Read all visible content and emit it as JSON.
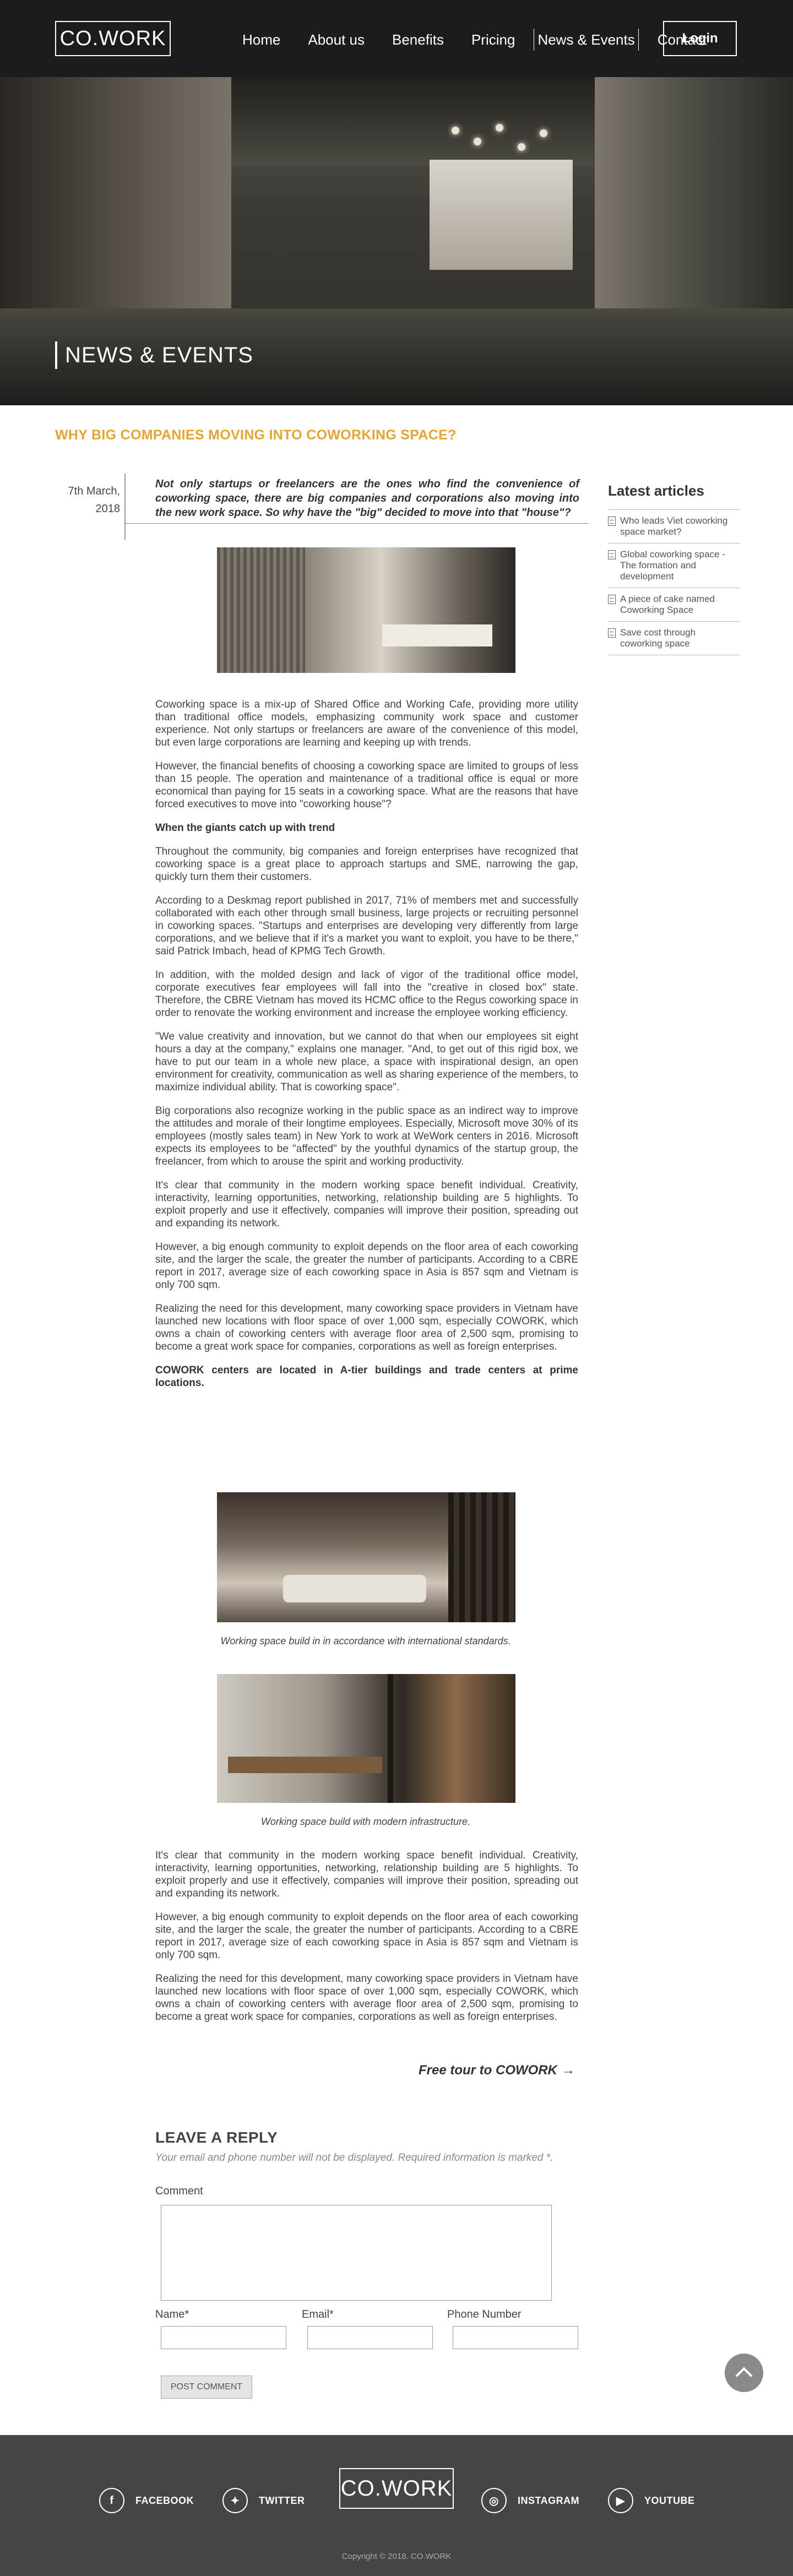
{
  "header": {
    "logo": "CO.WORK",
    "nav": [
      "Home",
      "About us",
      "Benefits",
      "Pricing",
      "News & Events",
      "Contact"
    ],
    "active_nav": "News & Events",
    "login": "Login"
  },
  "hero": {
    "title": "NEWS & EVENTS"
  },
  "article": {
    "title": "WHY BIG COMPANIES MOVING INTO COWORKING SPACE?",
    "date_line1": "7th March,",
    "date_line2": "2018",
    "intro": "Not only startups or freelancers are the ones who find the convenience of coworking space, there are big companies and corporations also moving into the new work space. So why have the \"big\" decided to move into that \"house\"?",
    "paragraphs_a": [
      "Coworking space is a mix-up of Shared Office and Working Cafe, providing more utility than traditional office models, emphasizing community work space and customer experience. Not only startups or freelancers are aware of the convenience of this model, but even large corporations are learning and keeping up with trends.",
      "However, the financial benefits of choosing a coworking space are limited to groups of less than 15 people. The operation and maintenance of a traditional office is equal or more economical than paying for 15 seats in a coworking space. What are the reasons that have forced executives to move into \"coworking house\"?"
    ],
    "subheading": "When the giants catch up with trend",
    "paragraphs_b": [
      "Throughout the community, big companies and foreign enterprises have recognized that coworking space is a great place to approach startups and SME, narrowing the gap, quickly turn them their customers.",
      "According to a Deskmag report published in 2017, 71% of members met and successfully collaborated with each other through small business, large projects or recruiting personnel in coworking spaces. \"Startups and enterprises are developing very differently from large corporations, and we believe that if it's a market you want to exploit, you have to be there,\" said Patrick Imbach, head of KPMG Tech Growth.",
      "In addition, with the molded design and lack of vigor of the traditional office model, corporate executives fear employees will fall into the \"creative in closed box\" state. Therefore, the CBRE Vietnam has moved its HCMC office to the Regus coworking space in order to renovate the working environment and increase the employee working efficiency.",
      "\"We value creativity and innovation, but we cannot do that when our employees sit eight hours a day at the company,\" explains one manager. \"And, to get out of this rigid box, we have to put our team in a whole new place, a space with inspirational design, an open environment for creativity, communication as well as sharing experience of the members, to maximize individual ability. That is coworking space\".",
      "Big corporations also recognize working in the public space as an indirect way to improve the attitudes and morale of their longtime employees. Especially, Microsoft move 30% of its employees (mostly sales team) in New York to work at WeWork centers in 2016. Microsoft expects its employees to be \"affected\" by the youthful dynamics of the startup group, the freelancer, from which to arouse the spirit and working productivity.",
      "It's clear that community in the modern working space benefit individual. Creativity, interactivity, learning opportunities, networking, relationship building are 5 highlights. To exploit properly and use it effectively, companies will improve their position, spreading out and expanding its network.",
      "However, a big enough community to exploit depends on the floor area of each coworking site, and the larger the scale, the greater the number of participants. According to a CBRE report in 2017, average size of each coworking space in Asia is 857 sqm and Vietnam is only 700 sqm.",
      "Realizing the need for this development, many coworking space providers in Vietnam have launched new locations with floor space of over 1,000 sqm, especially COWORK, which owns a chain of coworking centers with average floor area of 2,500 sqm, promising to become a great work space for companies, corporations as well as foreign enterprises."
    ],
    "bold_statement": "COWORK centers are located in A-tier buildings and trade centers at prime locations.",
    "caption1": "Working space build in in accordance with international standards.",
    "caption2": "Working space build with modern infrastructure.",
    "paragraphs_c": [
      "It's clear that community in the modern working space benefit individual. Creativity, interactivity, learning opportunities, networking, relationship building are 5 highlights. To exploit properly and use it effectively, companies will improve their position, spreading out and expanding its network.",
      "However, a big enough community to exploit depends on the floor area of each coworking site, and the larger the scale, the greater the number of participants. According to a CBRE report in 2017, average size of each coworking space in Asia is 857 sqm and Vietnam is only 700 sqm.",
      "Realizing the need for this development, many coworking space providers in Vietnam have launched new locations with floor space of over 1,000 sqm, especially COWORK, which owns a chain of coworking centers with average floor area of 2,500 sqm, promising to become a great work space for companies, corporations as well as foreign enterprises."
    ],
    "free_tour": "Free tour to COWORK",
    "free_tour_arrow": "→"
  },
  "sidebar": {
    "title": "Latest articles",
    "items": [
      "Who leads Viet coworking space market?",
      "Global coworking space - The formation and development",
      "A piece of cake named Coworking Space",
      "Save cost through coworking space"
    ]
  },
  "reply": {
    "title": "LEAVE A REPLY",
    "note": "Your email and phone number will not be displayed. Required information is marked *.",
    "comment_label": "Comment",
    "name_label": "Name*",
    "email_label": "Email*",
    "phone_label": "Phone Number",
    "post_button": "POST COMMENT"
  },
  "footer": {
    "facebook": "FACEBOOK",
    "twitter": "TWITTER",
    "logo": "CO.WORK",
    "instagram": "INSTAGRAM",
    "youtube": "YOUTUBE",
    "copyright": "Copyright © 2018. CO.WORK"
  }
}
